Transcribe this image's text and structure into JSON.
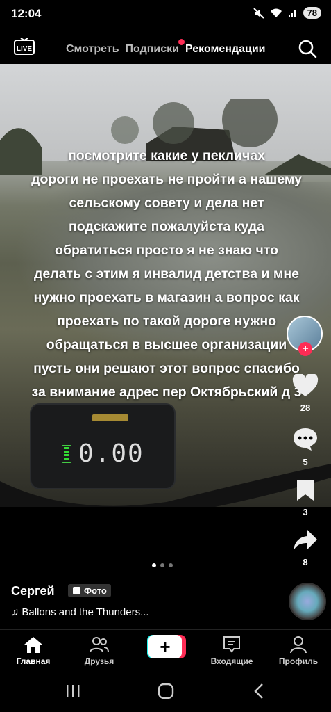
{
  "status": {
    "time": "12:04",
    "battery": "78"
  },
  "topnav": {
    "live_label": "LIVE",
    "tabs": [
      "Смотреть",
      "Подписки",
      "Рекомендации"
    ]
  },
  "video": {
    "caption_lines": [
      "посмотрите какие у пекличах",
      "дороги не проехать не пройти а нашему",
      "сельскому совету и дела нет",
      "подскажите пожалуйста куда",
      "обратиться просто я не знаю что",
      "делать с этим я инвалид детства и мне",
      "нужно проехать в магазин а вопрос как",
      "проехать по такой дороге нужно",
      "обращаться в высшее организации",
      "пусть они решают этот вопрос спасибо",
      "за внимание адрес пер Октябрьский д 3"
    ],
    "display_value": "0.00"
  },
  "actions": {
    "likes": "28",
    "comments": "5",
    "saves": "3",
    "shares": "8"
  },
  "post": {
    "author": "Сергей",
    "badge": "Фото",
    "music": "Ballons and the Thunders..."
  },
  "bottomnav": {
    "home": "Главная",
    "friends": "Друзья",
    "inbox": "Входящие",
    "profile": "Профиль"
  },
  "colors": {
    "accent": "#fe2c55",
    "cyan": "#25f4ee",
    "background": "#000000"
  }
}
